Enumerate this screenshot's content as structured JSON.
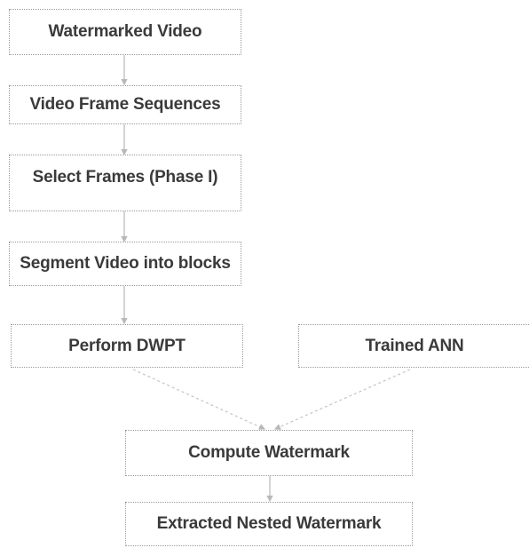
{
  "nodes": {
    "watermarked_video": "Watermarked Video",
    "frame_sequences": "Video Frame Sequences",
    "select_frames": "Select Frames (Phase I)",
    "segment_blocks": "Segment Video into blocks",
    "perform_dwpt": "Perform DWPT",
    "trained_ann": "Trained ANN",
    "compute_watermark": "Compute Watermark",
    "extracted_watermark": "Extracted Nested Watermark"
  },
  "colors": {
    "box_border": "#9a9a9a",
    "arrow": "#b8b8b8",
    "text": "#3a3a3a"
  }
}
